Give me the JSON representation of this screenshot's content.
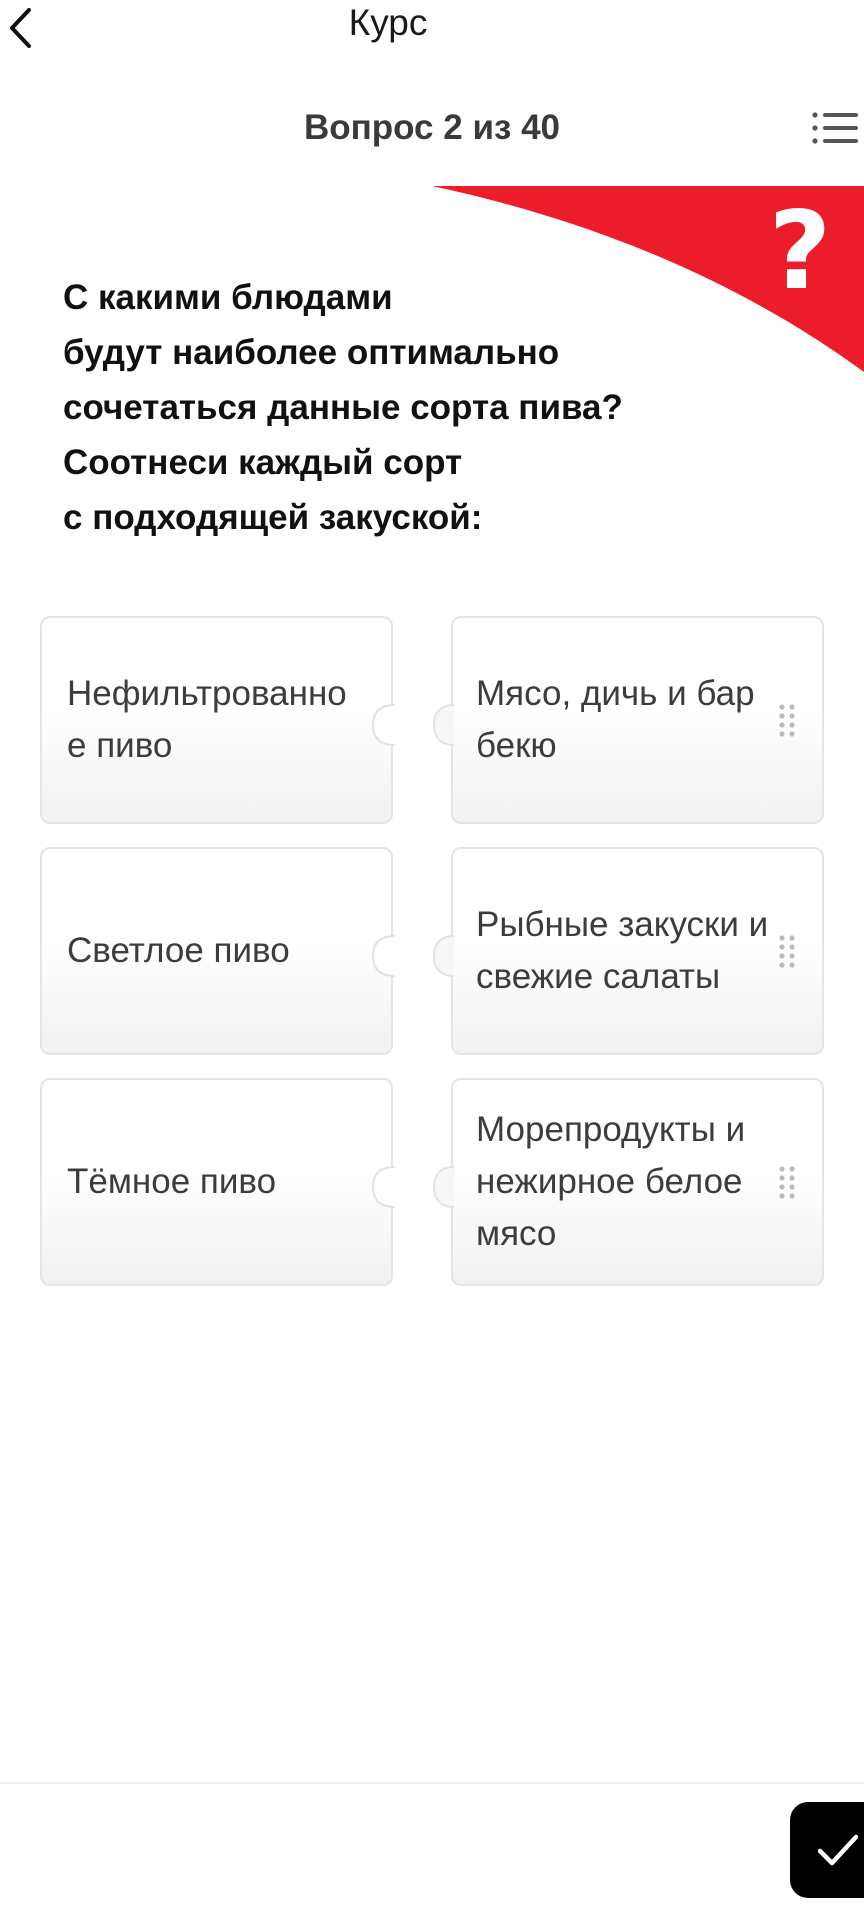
{
  "header": {
    "title": "Курс",
    "back_icon": "chevron-left-icon"
  },
  "question_bar": {
    "counter": "Вопрос 2 из 40",
    "menu_icon": "list-menu-icon"
  },
  "question": {
    "text": "С какими блюдами\nбудут наиболее оптимально\nсочетаться данные сорта пива?\nСоотнеси каждый сорт\nс подходящей закуской:",
    "badge_icon": "question-mark-icon",
    "accent_color": "#ED1C2B"
  },
  "matching": {
    "pairs": [
      {
        "left": "Нефильтрованное пиво",
        "right": "Мясо, дичь и барбекю"
      },
      {
        "left": "Светлое пиво",
        "right": "Рыбные закуски и свежие салаты"
      },
      {
        "left": "Тёмное пиво",
        "right": "Морепродукты и нежирное белое мясо"
      }
    ]
  },
  "footer": {
    "submit_icon": "checkmark-icon"
  }
}
